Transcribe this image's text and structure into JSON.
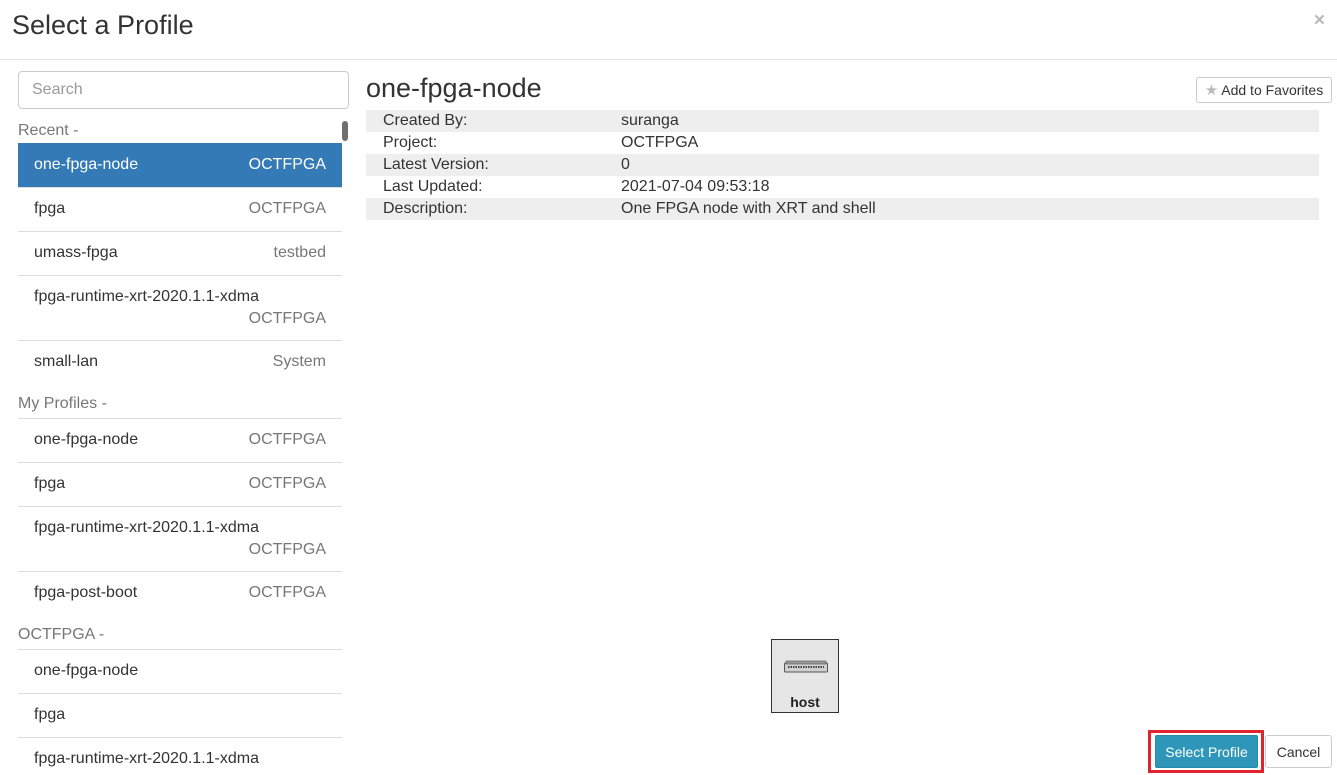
{
  "modal": {
    "title": "Select a Profile",
    "close": "×"
  },
  "search": {
    "placeholder": "Search",
    "value": ""
  },
  "groups": [
    {
      "label": "Recent -",
      "items": [
        {
          "name": "one-fpga-node",
          "project": "OCTFPGA",
          "selected": true
        },
        {
          "name": "fpga",
          "project": "OCTFPGA"
        },
        {
          "name": "umass-fpga",
          "project": "testbed"
        },
        {
          "name": "fpga-runtime-xrt-2020.1.1-xdma",
          "project": "OCTFPGA"
        },
        {
          "name": "small-lan",
          "project": "System"
        }
      ]
    },
    {
      "label": "My Profiles -",
      "items": [
        {
          "name": "one-fpga-node",
          "project": "OCTFPGA"
        },
        {
          "name": "fpga",
          "project": "OCTFPGA"
        },
        {
          "name": "fpga-runtime-xrt-2020.1.1-xdma",
          "project": "OCTFPGA"
        },
        {
          "name": "fpga-post-boot",
          "project": "OCTFPGA"
        }
      ]
    },
    {
      "label": "OCTFPGA -",
      "items": [
        {
          "name": "one-fpga-node",
          "project": ""
        },
        {
          "name": "fpga",
          "project": ""
        },
        {
          "name": "fpga-runtime-xrt-2020.1.1-xdma",
          "project": ""
        }
      ]
    }
  ],
  "detail": {
    "title": "one-fpga-node",
    "favorites_label": "Add to Favorites",
    "favorites_icon": "star-icon",
    "info": [
      {
        "label": "Created By:",
        "value": "suranga"
      },
      {
        "label": "Project:",
        "value": "OCTFPGA"
      },
      {
        "label": "Latest Version:",
        "value": "0"
      },
      {
        "label": "Last Updated:",
        "value": "2021-07-04 09:53:18"
      },
      {
        "label": "Description:",
        "value": "One FPGA node with XRT and shell"
      }
    ],
    "topology": {
      "node_label": "host",
      "node_icon": "server-icon"
    }
  },
  "footer": {
    "select_label": "Select Profile",
    "cancel_label": "Cancel"
  },
  "colors": {
    "selected_bg": "#337ab7",
    "primary_button": "#2e96b8",
    "highlight_border": "#e0232f"
  }
}
